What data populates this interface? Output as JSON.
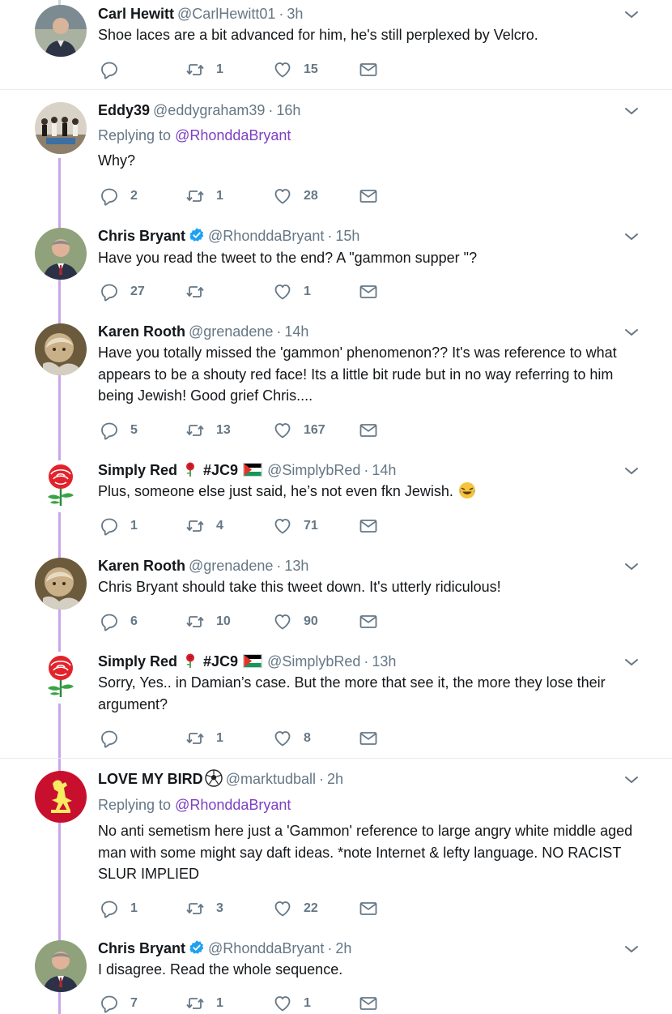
{
  "colors": {
    "name": "#14171a",
    "muted": "#657786",
    "mention": "#7d3fc2",
    "thread_line": "#c9a6ea",
    "separator": "#e6ecf0",
    "verified": "#1da1f2"
  },
  "tweets": [
    {
      "name": "Carl Hewitt",
      "handle": "@CarlHewitt01",
      "time": "3h",
      "text": "Shoe laces are a bit advanced for him, he's still perplexed by Velcro.",
      "reply_count": "",
      "retweet_count": "1",
      "like_count": "15"
    },
    {
      "name": "Eddy39",
      "handle": "@eddygraham39",
      "time": "16h",
      "replying_prefix": "Replying to",
      "replying_to": "@RhonddaBryant",
      "text": "Why?",
      "reply_count": "2",
      "retweet_count": "1",
      "like_count": "28"
    },
    {
      "name": "Chris Bryant",
      "handle": "@RhonddaBryant",
      "time": "15h",
      "text": "Have you read the tweet to the end? A \"gammon supper \"?",
      "reply_count": "27",
      "retweet_count": "",
      "like_count": "1"
    },
    {
      "name": "Karen Rooth",
      "handle": "@grenadene",
      "time": "14h",
      "text": "Have you totally missed the 'gammon' phenomenon?? It's was reference to what appears to be a shouty red face! Its a little bit rude but in no way referring to him being Jewish! Good grief Chris....",
      "reply_count": "5",
      "retweet_count": "13",
      "like_count": "167"
    },
    {
      "name": "Simply Red",
      "name_suffix": "#JC9",
      "handle": "@SimplybRed",
      "time": "14h",
      "text": "Plus, someone else just said, he’s not even fkn Jewish.",
      "reply_count": "1",
      "retweet_count": "4",
      "like_count": "71"
    },
    {
      "name": "Karen Rooth",
      "handle": "@grenadene",
      "time": "13h",
      "text": "Chris Bryant should take this tweet down. It's utterly ridiculous!",
      "reply_count": "6",
      "retweet_count": "10",
      "like_count": "90"
    },
    {
      "name": "Simply Red",
      "name_suffix": "#JC9",
      "handle": "@SimplybRed",
      "time": "13h",
      "text": "Sorry, Yes.. in Damian’s case. But the more that see it, the more they lose their argument?",
      "reply_count": "",
      "retweet_count": "1",
      "like_count": "8"
    },
    {
      "name": "LOVE MY BIRD",
      "handle": "@marktudball",
      "time": "2h",
      "replying_prefix": "Replying to",
      "replying_to": "@RhonddaBryant",
      "text": "No anti semetism here just a 'Gammon' reference to large angry white middle aged man with some might say daft ideas. *note Internet & lefty language. NO RACIST SLUR IMPLIED",
      "reply_count": "1",
      "retweet_count": "3",
      "like_count": "22"
    },
    {
      "name": "Chris Bryant",
      "handle": "@RhonddaBryant",
      "time": "2h",
      "text": "I disagree. Read the whole sequence.",
      "reply_count": "7",
      "retweet_count": "1",
      "like_count": "1"
    }
  ]
}
